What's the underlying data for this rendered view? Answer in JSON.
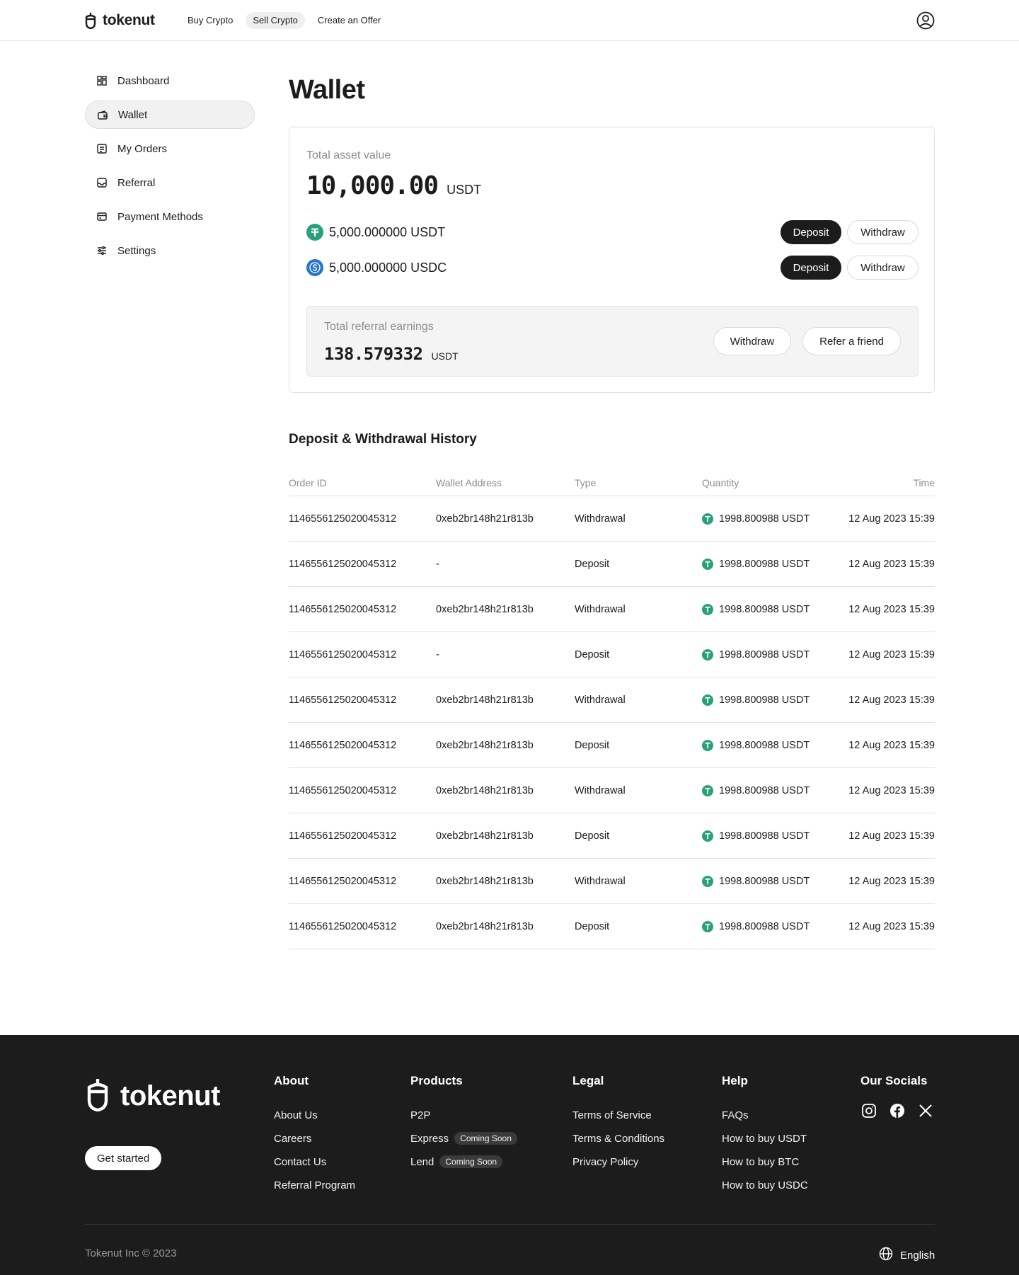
{
  "header": {
    "brand": "tokenut",
    "nav": [
      {
        "label": "Buy Crypto"
      },
      {
        "label": "Sell Crypto"
      },
      {
        "label": "Create an Offer"
      }
    ],
    "profile_icon": "user-circle-icon"
  },
  "sidebar": {
    "items": [
      {
        "label": "Dashboard",
        "icon": "grid-icon"
      },
      {
        "label": "Wallet",
        "icon": "wallet-icon",
        "active": true
      },
      {
        "label": "My Orders",
        "icon": "orders-icon"
      },
      {
        "label": "Referral",
        "icon": "inbox-icon"
      },
      {
        "label": "Payment Methods",
        "icon": "credit-card-icon"
      },
      {
        "label": "Settings",
        "icon": "sliders-icon"
      }
    ]
  },
  "main": {
    "title": "Wallet",
    "wallet": {
      "total_label": "Total asset value",
      "total_amount": "10,000.00",
      "total_unit": "USDT",
      "coins": [
        {
          "balance": "5,000.000000 USDT",
          "icon": "tether-icon",
          "color": "#26a17b",
          "deposit_label": "Deposit",
          "withdraw_label": "Withdraw"
        },
        {
          "balance": "5,000.000000 USDC",
          "icon": "usdc-icon",
          "color": "#2775ca",
          "deposit_label": "Deposit",
          "withdraw_label": "Withdraw"
        }
      ],
      "referral": {
        "label": "Total referral earnings",
        "amount": "138.579332",
        "unit": "USDT",
        "withdraw_label": "Withdraw",
        "refer_label": "Refer a friend"
      }
    },
    "history": {
      "title": "Deposit & Withdrawal History",
      "columns": [
        "Order ID",
        "Wallet Address",
        "Type",
        "Quantity",
        "Time"
      ],
      "rows": [
        {
          "order_id": "1146556125020045312",
          "address": "0xeb2br148h21r813b",
          "type": "Withdrawal",
          "quantity": "1998.800988 USDT",
          "time": "12 Aug 2023 15:39"
        },
        {
          "order_id": "1146556125020045312",
          "address": "-",
          "type": "Deposit",
          "quantity": "1998.800988 USDT",
          "time": "12 Aug 2023 15:39"
        },
        {
          "order_id": "1146556125020045312",
          "address": "0xeb2br148h21r813b",
          "type": "Withdrawal",
          "quantity": "1998.800988 USDT",
          "time": "12 Aug 2023 15:39"
        },
        {
          "order_id": "1146556125020045312",
          "address": "-",
          "type": "Deposit",
          "quantity": "1998.800988 USDT",
          "time": "12 Aug 2023 15:39"
        },
        {
          "order_id": "1146556125020045312",
          "address": "0xeb2br148h21r813b",
          "type": "Withdrawal",
          "quantity": "1998.800988 USDT",
          "time": "12 Aug 2023 15:39"
        },
        {
          "order_id": "1146556125020045312",
          "address": "0xeb2br148h21r813b",
          "type": "Deposit",
          "quantity": "1998.800988 USDT",
          "time": "12 Aug 2023 15:39"
        },
        {
          "order_id": "1146556125020045312",
          "address": "0xeb2br148h21r813b",
          "type": "Withdrawal",
          "quantity": "1998.800988 USDT",
          "time": "12 Aug 2023 15:39"
        },
        {
          "order_id": "1146556125020045312",
          "address": "0xeb2br148h21r813b",
          "type": "Deposit",
          "quantity": "1998.800988 USDT",
          "time": "12 Aug 2023 15:39"
        },
        {
          "order_id": "1146556125020045312",
          "address": "0xeb2br148h21r813b",
          "type": "Withdrawal",
          "quantity": "1998.800988 USDT",
          "time": "12 Aug 2023 15:39"
        },
        {
          "order_id": "1146556125020045312",
          "address": "0xeb2br148h21r813b",
          "type": "Deposit",
          "quantity": "1998.800988 USDT",
          "time": "12 Aug 2023 15:39"
        }
      ]
    }
  },
  "footer": {
    "brand": "tokenut",
    "get_started": "Get started",
    "columns": {
      "about": {
        "title": "About",
        "links": [
          "About Us",
          "Careers",
          "Contact Us",
          "Referral Program"
        ]
      },
      "products": {
        "title": "Products",
        "links": [
          {
            "label": "P2P"
          },
          {
            "label": "Express",
            "badge": "Coming Soon"
          },
          {
            "label": "Lend",
            "badge": "Coming Soon"
          }
        ]
      },
      "legal": {
        "title": "Legal",
        "links": [
          "Terms of Service",
          "Terms & Conditions",
          "Privacy Policy"
        ]
      },
      "help": {
        "title": "Help",
        "links": [
          "FAQs",
          "How to buy USDT",
          "How to buy BTC",
          "How to buy USDC"
        ]
      },
      "socials": {
        "title": "Our Socials",
        "icons": [
          "instagram-icon",
          "facebook-icon",
          "x-icon"
        ]
      }
    },
    "copyright": "Tokenut Inc © 2023",
    "language": "English"
  },
  "colors": {
    "accent_dark": "#1c1c1c",
    "tether_green": "#26a17b",
    "usdc_blue": "#2775ca",
    "footer_bg": "#1c1c1c"
  }
}
